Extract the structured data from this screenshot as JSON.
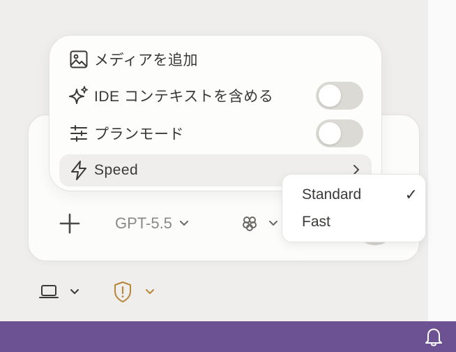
{
  "menu": {
    "items": [
      {
        "label": "メディアを追加",
        "icon": "image-icon"
      },
      {
        "label": "IDE コンテキストを含める",
        "icon": "sparkle-icon",
        "toggle": false
      },
      {
        "label": "プランモード",
        "icon": "sliders-icon",
        "toggle": false
      },
      {
        "label": "Speed",
        "icon": "lightning-icon",
        "has_submenu": true
      }
    ]
  },
  "speed_submenu": {
    "options": [
      "Standard",
      "Fast"
    ],
    "selected": "Standard"
  },
  "composer": {
    "model": "GPT-5.5"
  },
  "colors": {
    "status_bar": "#6d5293",
    "shield_accent": "#b8863a",
    "toggle_off": "#dcdad5"
  }
}
